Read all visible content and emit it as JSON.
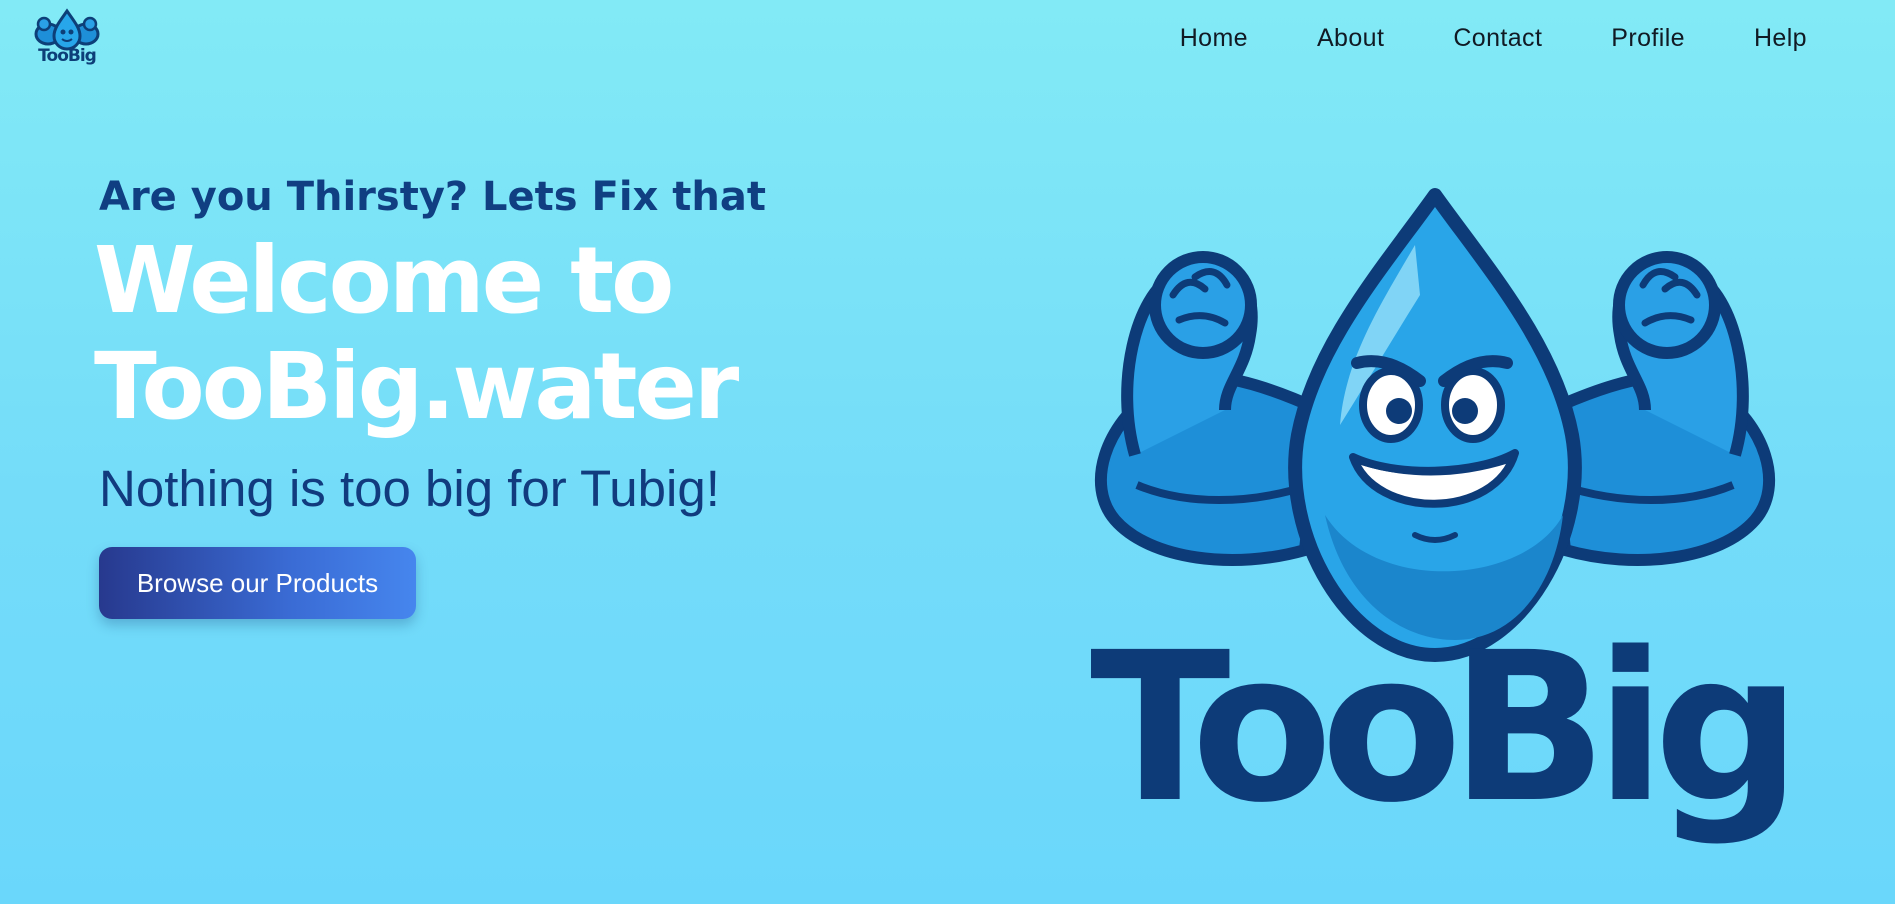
{
  "header": {
    "brand_name": "TooBig",
    "nav": [
      {
        "label": "Home"
      },
      {
        "label": "About"
      },
      {
        "label": "Contact"
      },
      {
        "label": "Profile"
      },
      {
        "label": "Help"
      }
    ]
  },
  "hero": {
    "subtitle": "Are you Thirsty? Lets Fix that",
    "title_line1": "Welcome to",
    "title_line2": "TooBig.water",
    "tagline": "Nothing is too big for Tubig!",
    "cta_label": "Browse our Products"
  },
  "mascot": {
    "wordmark": "TooBig",
    "icon": "muscular-water-drop-icon"
  },
  "colors": {
    "background_top": "#82eaf6",
    "background_bottom": "#6ad7fb",
    "subtitle": "#103f82",
    "title": "#ffffff",
    "cta_gradient_start": "#27398e",
    "cta_gradient_end": "#4686ee",
    "wordmark": "#0d3b78"
  }
}
